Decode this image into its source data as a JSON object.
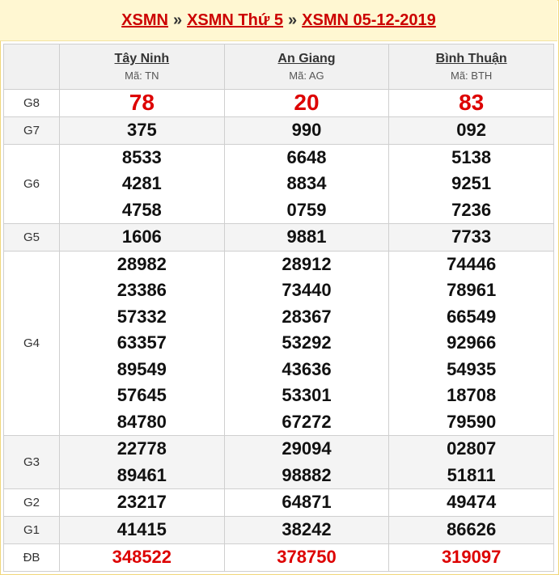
{
  "header": {
    "link1": "XSMN",
    "sep1": "»",
    "link2": "XSMN Thứ 5",
    "sep2": "»",
    "link3": "XSMN 05-12-2019"
  },
  "provinces": [
    {
      "name": "Tây Ninh",
      "code": "Mã: TN"
    },
    {
      "name": "An Giang",
      "code": "Mã: AG"
    },
    {
      "name": "Bình Thuận",
      "code": "Mã: BTH"
    }
  ],
  "prizes": {
    "g8": {
      "label": "G8",
      "values": [
        "78",
        "20",
        "83"
      ]
    },
    "g7": {
      "label": "G7",
      "values": [
        "375",
        "990",
        "092"
      ]
    },
    "g6": {
      "label": "G6",
      "values": [
        [
          "8533",
          "4281",
          "4758"
        ],
        [
          "6648",
          "8834",
          "0759"
        ],
        [
          "5138",
          "9251",
          "7236"
        ]
      ]
    },
    "g5": {
      "label": "G5",
      "values": [
        "1606",
        "9881",
        "7733"
      ]
    },
    "g4": {
      "label": "G4",
      "values": [
        [
          "28982",
          "23386",
          "57332",
          "63357",
          "89549",
          "57645",
          "84780"
        ],
        [
          "28912",
          "73440",
          "28367",
          "53292",
          "43636",
          "53301",
          "67272"
        ],
        [
          "74446",
          "78961",
          "66549",
          "92966",
          "54935",
          "18708",
          "79590"
        ]
      ]
    },
    "g3": {
      "label": "G3",
      "values": [
        [
          "22778",
          "89461"
        ],
        [
          "29094",
          "98882"
        ],
        [
          "02807",
          "51811"
        ]
      ]
    },
    "g2": {
      "label": "G2",
      "values": [
        "23217",
        "64871",
        "49474"
      ]
    },
    "g1": {
      "label": "G1",
      "values": [
        "41415",
        "38242",
        "86626"
      ]
    },
    "db": {
      "label": "ĐB",
      "values": [
        "348522",
        "378750",
        "319097"
      ]
    }
  }
}
